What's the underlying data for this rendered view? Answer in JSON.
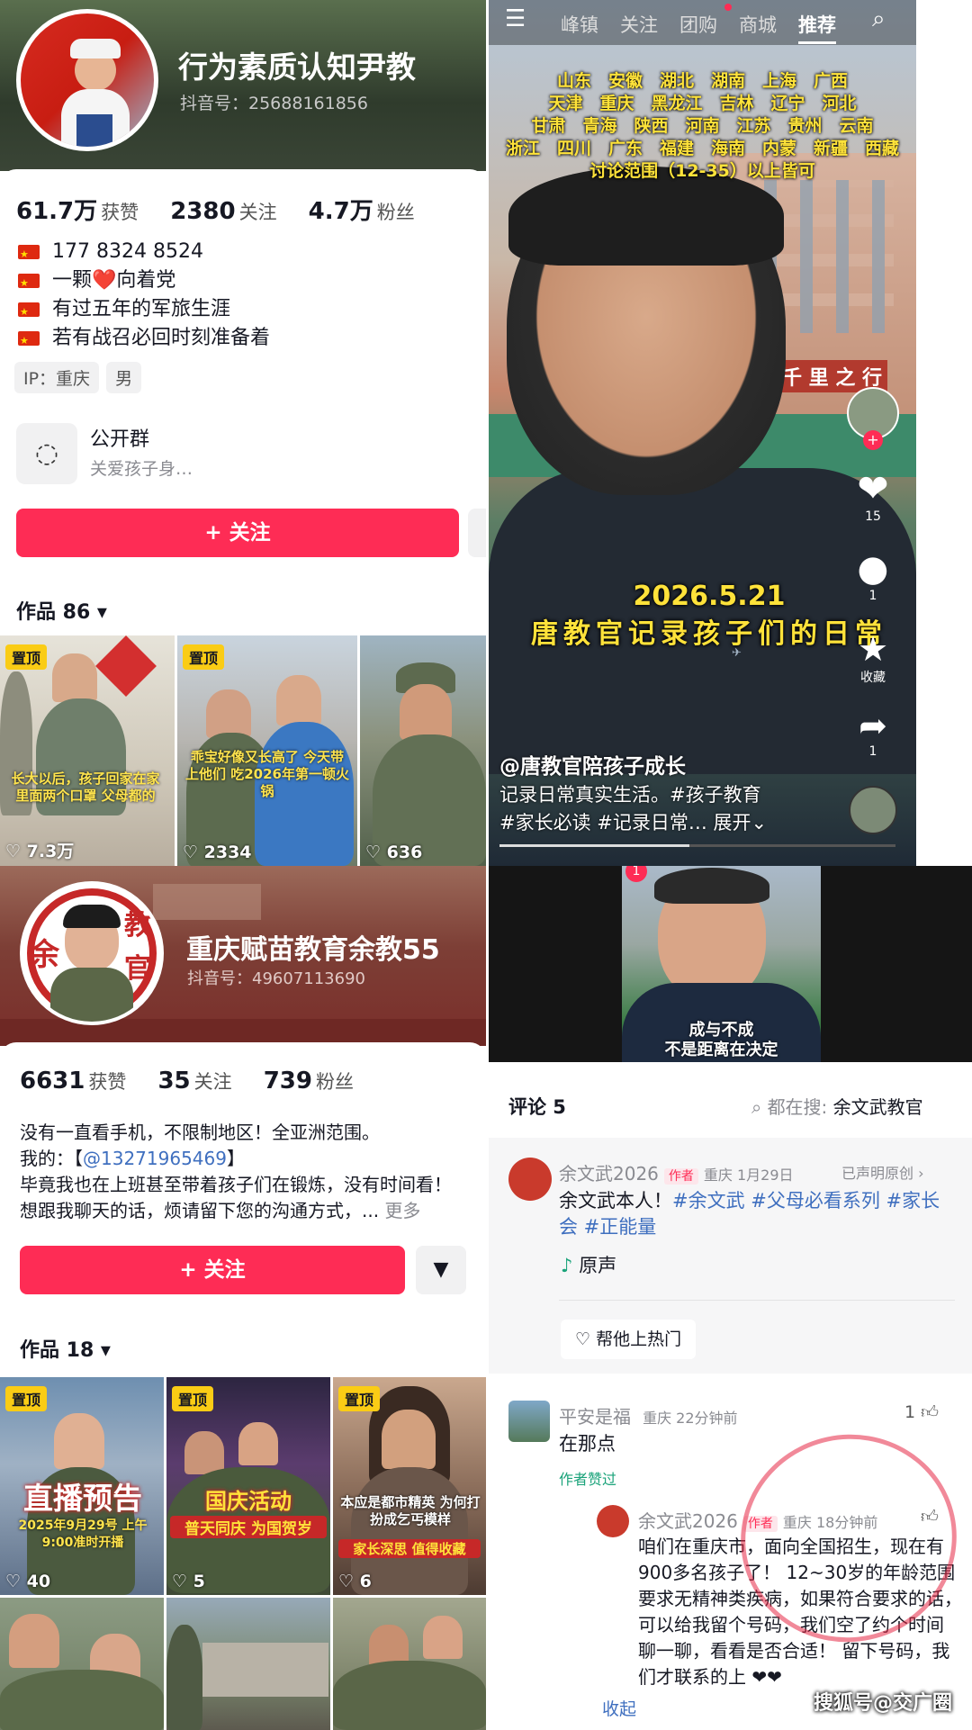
{
  "panel_a": {
    "name": "行为素质认知尹教",
    "douyin_id": "抖音号：25688161856",
    "stats": [
      {
        "value": "61.7万",
        "label": "获赞"
      },
      {
        "value": "2380",
        "label": "关注"
      },
      {
        "value": "4.7万",
        "label": "粉丝"
      }
    ],
    "bio_lines": [
      "177 8324 8524",
      "一颗❤️向着党",
      "有过五年的军旅生涯",
      "若有战召必回时刻准备着"
    ],
    "tags": [
      "IP：重庆",
      "男"
    ],
    "group": {
      "title": "公开群",
      "subtitle": "关爱孩子身…"
    },
    "follow_label": "+ 关注",
    "works_label": "作品 86 ▾",
    "videos": [
      {
        "pin": "置顶",
        "likes": "♡ 7.3万",
        "overlay": "长大以后，孩子回家在家里面两个口罩 父母都的"
      },
      {
        "pin": "置顶",
        "likes": "♡ 2334",
        "overlay": "乖宝好像又长高了 今天带上他们 吃2026年第一顿火锅"
      },
      {
        "pin": "",
        "likes": "♡ 636",
        "overlay": ""
      }
    ]
  },
  "panel_b": {
    "nav": [
      "峰镇",
      "关注",
      "团购",
      "商城",
      "推荐"
    ],
    "regions": [
      "山东　安徽　湖北　湖南　上海　广西",
      "天津　重庆　黑龙江　吉林　辽宁　河北",
      "甘肃　青海　陕西　河南　江苏　贵州　云南",
      "浙江　四川　广东　福建　海南　内蒙　新疆　西藏",
      "讨论范围（12-35）以上皆可"
    ],
    "date": "2026.5.21",
    "caption": "唐教官记录孩子们的日常",
    "side": {
      "likes": "15",
      "comments": "1",
      "favorite": "收藏",
      "share": "1"
    },
    "author": "@唐教官陪孩子成长",
    "desc_line1": "记录日常真实生活。#孩子教育",
    "desc_line2": "#家长必读 #记录日常…  展开⌄",
    "building_sign": "千 里 之 行"
  },
  "panel_c": {
    "name": "重庆赋苗教育余教55",
    "douyin_id": "抖音号：49607113690",
    "badge_chars": [
      "余",
      "教",
      "官"
    ],
    "stats": [
      {
        "value": "6631",
        "label": "获赞"
      },
      {
        "value": "35",
        "label": "关注"
      },
      {
        "value": "739",
        "label": "粉丝"
      }
    ],
    "bio_1": "没有一直看手机，不限制地区！全亚洲范围。",
    "bio_2_prefix": "我的：【",
    "bio_2_link": "@13271965469",
    "bio_2_suffix": "】",
    "bio_3": "毕竟我也在上班甚至带着孩子们在锻炼，没有时间看！",
    "bio_4": "想跟我聊天的话，烦请留下您的沟通方式，...",
    "more": "更多",
    "follow_label": "+ 关注",
    "works_label": "作品 18 ▾",
    "videos": [
      {
        "pin": "置顶",
        "likes": "♡ 40",
        "overlay1": "直播预告",
        "overlay2": "2025年9月29号 上午9:00准时开播"
      },
      {
        "pin": "置顶",
        "likes": "♡ 5",
        "overlay1": "国庆活动",
        "overlay2": "普天同庆 为国贺岁"
      },
      {
        "pin": "置顶",
        "likes": "♡ 6",
        "overlay1": "本应是都市精英 为何打扮成乞丐模样",
        "overlay2": "家长深思 值得收藏"
      }
    ]
  },
  "panel_d": {
    "video_caption_1": "成与不成",
    "video_caption_2": "不是距离在决定",
    "comments_label": "评论 5",
    "search_prefix": "都在搜:",
    "search_term": "余文武教官",
    "c1": {
      "user": "余文武2026",
      "author_tag": "作者",
      "meta": "重庆  1月29日",
      "right": "已声明原创 ›",
      "text_plain": "余文武本人！",
      "text_tags": "#余文武 #父母必看系列 #家长会 #正能量",
      "audio": "原声",
      "hot_btn": "帮他上热门"
    },
    "c2": {
      "user": "平安是福",
      "meta": "重庆  22分钟前",
      "likes": "1",
      "text": "在那点",
      "liked": "作者赞过"
    },
    "c3": {
      "user": "余文武2026",
      "author_tag": "作者",
      "meta": "重庆  18分钟前",
      "lines": [
        "咱们在重庆市，面向全国招生，现在有",
        "900多名孩子了！ 12~30岁的年龄范围",
        "要求无精神类疾病，如果符合要求的话，",
        "可以给我留个号码，我们空了约个时间",
        "聊一聊，看看是否合适！ 留下号码，我",
        "们才联系的上 ❤❤"
      ],
      "collapse": "收起"
    }
  },
  "watermark": "搜狐号@交广圈",
  "colors": {
    "accent": "#fe2c55",
    "pin": "#facc15",
    "link": "#3f6fbf"
  }
}
